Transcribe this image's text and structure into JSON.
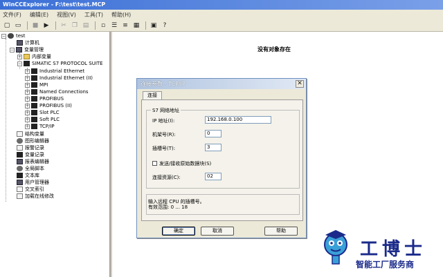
{
  "window": {
    "title": "WinCCExplorer - F:\\test\\test.MCP"
  },
  "menubar": [
    "文件(F)",
    "编辑(E)",
    "视图(V)",
    "工具(T)",
    "帮助(H)"
  ],
  "toolbar": {
    "icons": [
      "new-file-icon",
      "open-folder-icon",
      "stop-icon",
      "play-icon",
      "cut-icon",
      "copy-icon",
      "paste-icon",
      "small-icons-icon",
      "list-icon",
      "details-icon",
      "large-icons-icon",
      "properties-icon",
      "help-icon"
    ]
  },
  "tree": {
    "root": "test",
    "computer": "计算机",
    "tag_management": "变量管理",
    "internal_tags": "内部变量",
    "protocol_suite": "SIMATIC S7 PROTOCOL SUITE",
    "channels": [
      "Industrial Ethernet",
      "Industrial Ethernet (II)",
      "MPI",
      "Named Connections",
      "PROFIBUS",
      "PROFIBUS (II)",
      "Slot PLC",
      "Soft PLC",
      "TCP/IP"
    ],
    "others": [
      "结构变量",
      "图形编辑器",
      "报警记录",
      "变量记录",
      "报表编辑器",
      "全局脚本",
      "文本库",
      "用户管理器",
      "交叉索引",
      "加载在线修改"
    ]
  },
  "main": {
    "empty_message": "没有对象存在"
  },
  "dialog": {
    "title": "连接参数 - TCP/IP",
    "tab": "连接",
    "group_label": "S7 网络地址",
    "ip_label": "IP 地址(I):",
    "ip_value": "192.168.0.100",
    "rack_label": "机架号(R):",
    "rack_value": "0",
    "slot_label": "插槽号(T):",
    "slot_value": "3",
    "raw_checkbox_label": "发送/接收原始数据块(S)",
    "raw_checked": false,
    "conn_label": "连接资源(C):",
    "conn_value": "02",
    "info_line1": "输入远程 CPU 的插槽号。",
    "info_line2": "有效范围: 0 ... 18",
    "ok": "确定",
    "cancel": "取消",
    "help": "帮助"
  },
  "watermark": {
    "name": "工博士",
    "tagline": "智能工厂服务商",
    "color": "#1a2a8a"
  }
}
